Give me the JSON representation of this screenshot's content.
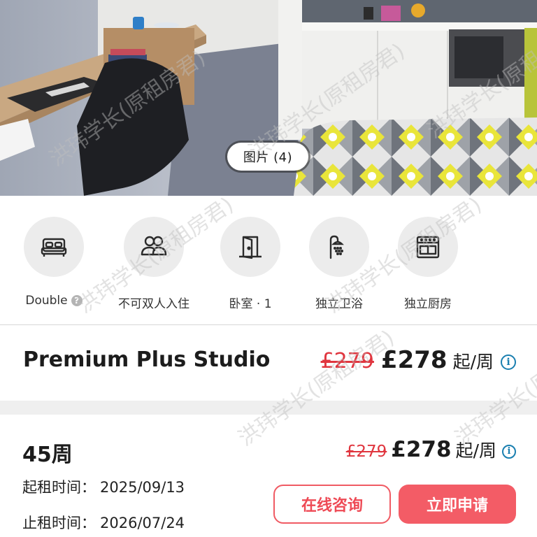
{
  "photo": {
    "badge_label": "图片 (4)"
  },
  "amenities": [
    {
      "icon": "bed-icon",
      "label": "Double",
      "has_help": true
    },
    {
      "icon": "people-icon",
      "label": "不可双人入住",
      "has_help": false
    },
    {
      "icon": "door-icon",
      "label": "卧室 · 1",
      "has_help": false
    },
    {
      "icon": "shower-icon",
      "label": "独立卫浴",
      "has_help": false
    },
    {
      "icon": "stove-icon",
      "label": "独立厨房",
      "has_help": false
    }
  ],
  "room": {
    "title": "Premium Plus Studio",
    "old_price": "£279",
    "new_price": "£278",
    "unit": "起/周"
  },
  "lease": {
    "weeks": "45周",
    "old_price": "£279",
    "new_price": "£278",
    "unit": "起/周",
    "start_label": "起租时间：",
    "start_value": "2025/09/13",
    "end_label": "止租时间：",
    "end_value": "2026/07/24"
  },
  "buttons": {
    "consult_label": "在线咨询",
    "apply_label": "立即申请"
  },
  "watermark": "洪玮学长(原租房君)",
  "colors": {
    "accent": "#f35c66",
    "strike_price": "#e0363f",
    "info_blue": "#1a7fb0"
  }
}
